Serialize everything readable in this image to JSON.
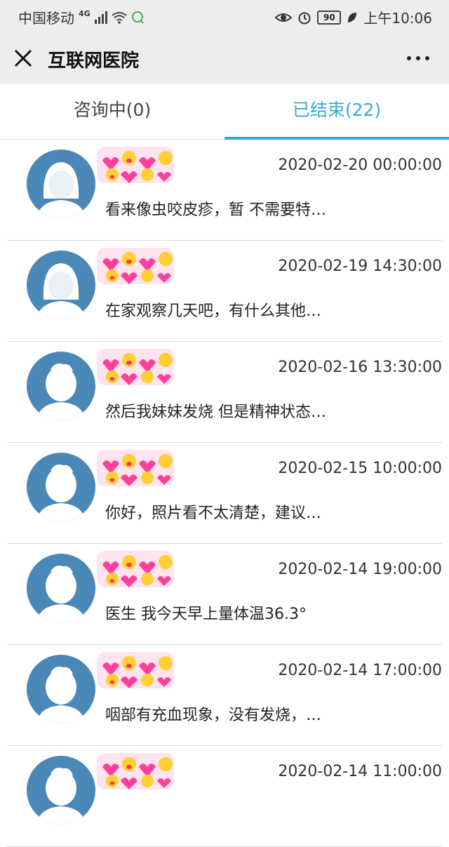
{
  "status_bar": {
    "carrier": "中国移动",
    "network": "4G",
    "battery": "90",
    "time": "上午10:06"
  },
  "nav": {
    "title": "互联网医院"
  },
  "tabs": [
    {
      "label": "咨询中(0)",
      "active": false
    },
    {
      "label": "已结束(22)",
      "active": true
    }
  ],
  "accent_color": "#33a9d9",
  "avatar_color": "#4a88b8",
  "list": [
    {
      "date": "2020-02-20 00:00:00",
      "preview": "看来像虫咬皮疹，暂 不需要特…",
      "avatar": "female-avatar-icon"
    },
    {
      "date": "2020-02-19 14:30:00",
      "preview": "在家观察几天吧，有什么其他…",
      "avatar": "female-avatar-icon"
    },
    {
      "date": "2020-02-16 13:30:00",
      "preview": "然后我妹妹发烧 但是精神状态…",
      "avatar": "child-avatar-icon"
    },
    {
      "date": "2020-02-15 10:00:00",
      "preview": "你好，照片看不太清楚，建议…",
      "avatar": "child-avatar-icon"
    },
    {
      "date": "2020-02-14 19:00:00",
      "preview": "医生 我今天早上量体温36.3°",
      "avatar": "child-avatar-icon"
    },
    {
      "date": "2020-02-14 17:00:00",
      "preview": "咽部有充血现象，没有发烧，…",
      "avatar": "child-avatar-icon"
    },
    {
      "date": "2020-02-14 11:00:00",
      "preview": "",
      "avatar": "child-avatar-icon"
    }
  ]
}
